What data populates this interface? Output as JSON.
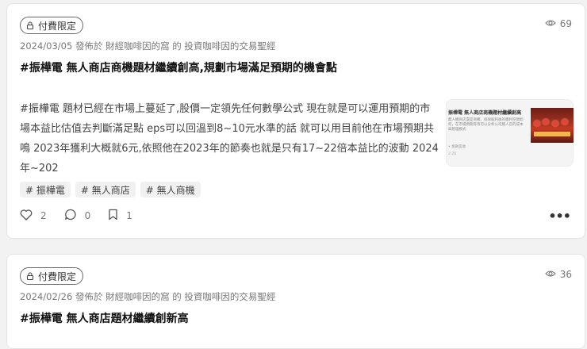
{
  "posts": [
    {
      "badge": "付費限定",
      "views": "69",
      "meta": "2024/03/05 發佈於 財經咖啡因的窩 的 投資咖啡因的交易聖經",
      "title": "#振樺電 無人商店商機題材繼續創高,規劃市場滿足預期的機會點",
      "excerpt": "#振樺電 題材已經在市場上蔓延了,股價一定領先任何數學公式 現在就是可以運用預期的市場本益比估值去判斷滿足點 eps可以回溫到8~10元水準的話 就可以用目前他在市場預期共鳴 2023年獲利大概就6元,依照他在2023年的節奏也就是只有17~22倍本益比的波動 2024年~202",
      "thumbnail": {
        "title": "振樺電 無人商店商機題材繼續創高",
        "excerpt": "無人機商店還是商機、扣除股利後的獲利空間如何，在市場預期等等可以分析公司無人店的成本與管理模式",
        "author": "• 金融室收",
        "date": "2-26"
      },
      "tags": [
        "# 振樺電",
        "# 無人商店",
        "# 無人商機"
      ],
      "likes": "2",
      "comments": "0",
      "bookmarks": "1",
      "more_label": "•••"
    },
    {
      "badge": "付費限定",
      "views": "36",
      "meta": "2024/02/26 發佈於 財經咖啡因的窩 的 投資咖啡因的交易聖經",
      "title": "#振樺電 無人商店題材繼續創新高"
    }
  ],
  "icons": {
    "badge": "lock-icon",
    "views": "eye-icon",
    "like": "heart-icon",
    "comment": "comment-icon",
    "bookmark": "bookmark-icon",
    "more": "more-icon"
  },
  "colors": {
    "background": "#f2f2f2",
    "card": "#ffffff",
    "title": "#111111",
    "meta": "#777777"
  }
}
